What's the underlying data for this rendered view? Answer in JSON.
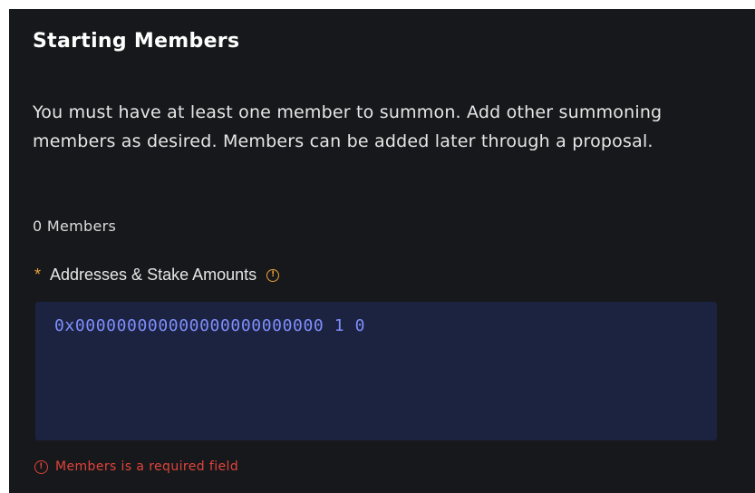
{
  "section": {
    "title": "Starting Members",
    "description": "You must have at least one member to summon. Add other summoning members as desired. Members can be added later through a proposal.",
    "member_count": "0 Members"
  },
  "field": {
    "required_marker": "*",
    "label": "Addresses & Stake Amounts",
    "info_icon": "info-circle-icon",
    "value": "0x000000000000000000000000 1 0"
  },
  "error": {
    "icon": "alert-circle-icon",
    "message": "Members is a required field"
  },
  "colors": {
    "panel_bg": "#17181b",
    "textarea_bg": "#1c2340",
    "textarea_text": "#7f8fff",
    "warning": "#e8a33a",
    "error": "#e0443a"
  }
}
